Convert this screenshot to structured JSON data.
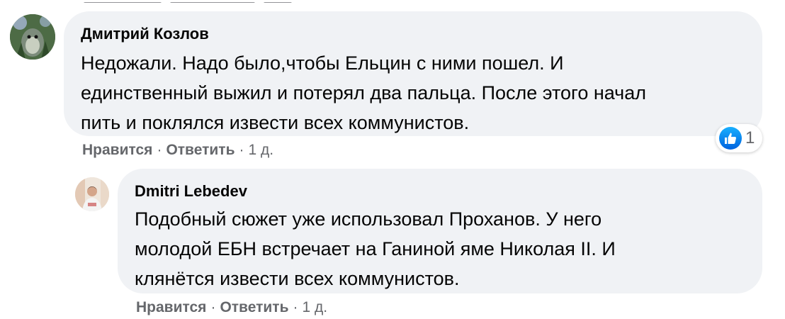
{
  "comments": [
    {
      "author": "Дмитрий Козлов",
      "lines": [
        "Недожали. Надо было,чтобы Ельцин с ними пошел. И",
        "единственный выжил и потерял два пальца. После этого начал",
        "пить и поклялся извести всех коммунистов."
      ],
      "like_label": "Нравится",
      "reply_label": "Ответить",
      "separator": "·",
      "time": "1 д.",
      "reaction_icon": "like-icon",
      "reaction_count": "1"
    },
    {
      "author": "Dmitri Lebedev",
      "lines": [
        "Подобный сюжет уже использовал Проханов. У него",
        "молодой ЕБН встречает на Ганиной яме Николая II. И",
        "клянётся извести всех коммунистов."
      ],
      "like_label": "Нравится",
      "reply_label": "Ответить",
      "separator": "·",
      "time": "1 д."
    }
  ],
  "colors": {
    "bubble_bg": "#f0f2f5",
    "meta_text": "#65676b",
    "like_blue": "#1877f2"
  }
}
